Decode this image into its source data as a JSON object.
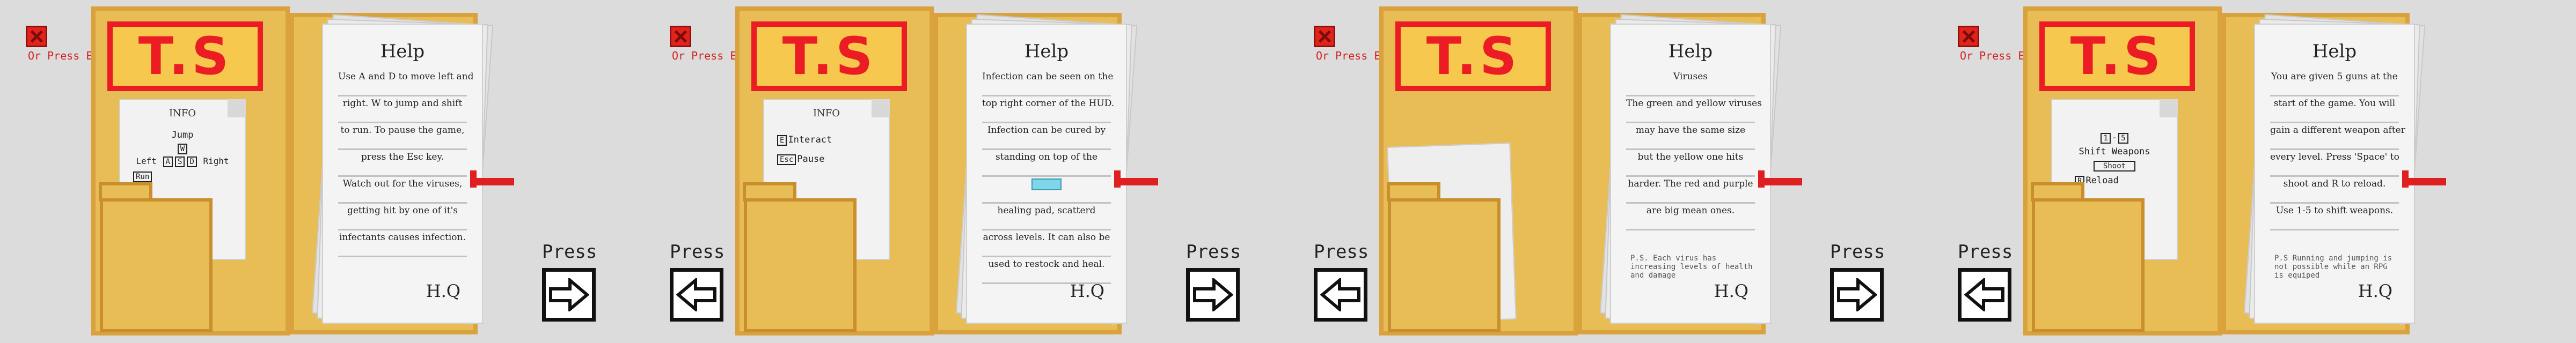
{
  "close_label": "Or Press Esc",
  "logo": "T.S",
  "signature": "H.Q",
  "nav": {
    "press_label": "Press"
  },
  "panels": [
    {
      "title": "Help",
      "lines": [
        "Use A and D to move left and",
        "right. W to jump and shift",
        "to run. To pause the game,",
        "press the Esc key.",
        "Watch out for the viruses,",
        "getting hit by one of it's",
        "infectants causes infection."
      ],
      "info": {
        "title": "INFO",
        "jump": "Jump",
        "w": "W",
        "left": "Left",
        "a": "A",
        "s": "S",
        "d": "D",
        "right": "Right",
        "run": "Run"
      }
    },
    {
      "title": "Help",
      "lines": [
        "Infection can be seen on the",
        "top right corner of the HUD.",
        "Infection can be cured by",
        "standing on top of the",
        "healing pad, scatterd",
        "across levels. It can also be",
        "used to restock and heal."
      ],
      "info": {
        "title": "INFO",
        "e": "E",
        "interact": "Interact",
        "esc": "Esc",
        "pause": "Pause"
      }
    },
    {
      "title": "Help",
      "subtitle": "Viruses",
      "lines": [
        "The green and yellow viruses",
        "may have the same size",
        "but the yellow one hits",
        "harder. The red and purple",
        "are big mean ones."
      ],
      "ps": "P.S. Each virus has increasing levels of health and damage"
    },
    {
      "title": "Help",
      "lines": [
        "You are given 5 guns at the",
        "start of the game. You will",
        "gain a different weapon after",
        "every level. Press 'Space' to",
        "shoot and R to reload.",
        "Use 1-5 to shift weapons."
      ],
      "ps": "P.S Running and jumping is not possible while an RPG is equiped",
      "info": {
        "k1": "1",
        "k5": "5",
        "shift": "Shift Weapons",
        "shoot": "Shoot",
        "r": "R",
        "reload": "Reload"
      }
    }
  ]
}
